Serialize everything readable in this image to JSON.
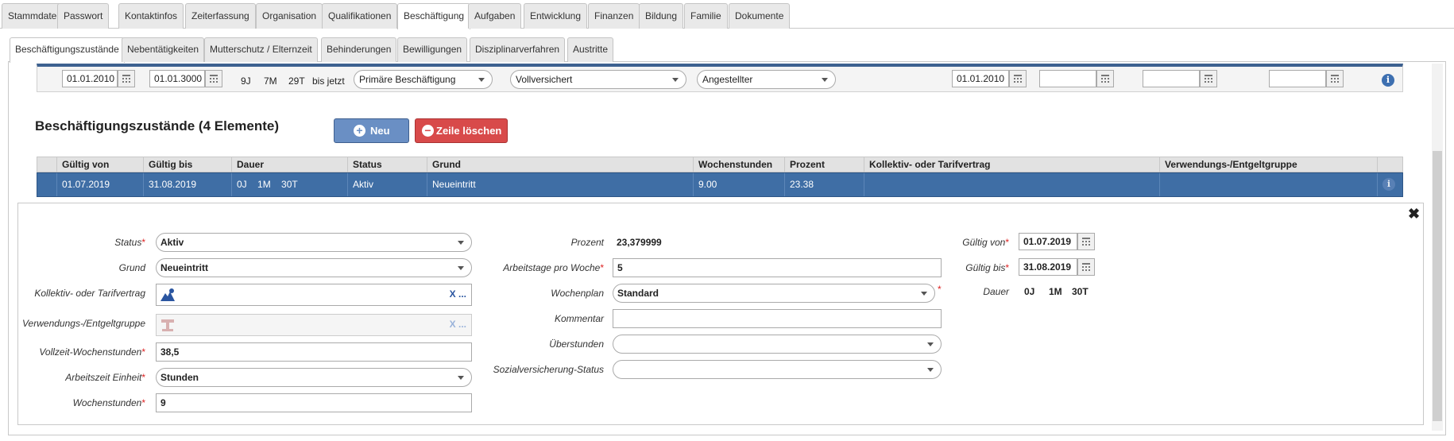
{
  "tabs_main": [
    "Stammdaten",
    "Passwort",
    "Kontaktinfos",
    "Zeiterfassung",
    "Organisation",
    "Qualifikationen",
    "Beschäftigung",
    "Aufgaben",
    "Entwicklung",
    "Finanzen",
    "Bildung",
    "Familie",
    "Dokumente"
  ],
  "tabs_main_active": "Beschäftigung",
  "tabs_sub": [
    "Beschäftigungszustände",
    "Nebentätigkeiten",
    "Mutterschutz / Elternzeit",
    "Behinderungen",
    "Bewilligungen",
    "Disziplinarverfahren",
    "Austritte"
  ],
  "tabs_sub_active": "Beschäftigungszustände",
  "top_row": {
    "from": "01.01.2010",
    "to": "01.01.3000",
    "dur_y": "9J",
    "dur_m": "7M",
    "dur_d": "29T",
    "until": "bis jetzt",
    "employment": "Primäre Beschäftigung",
    "insurance": "Vollversichert",
    "type": "Angestellter",
    "date2": "01.01.2010",
    "date3": "",
    "date4": "",
    "date5": ""
  },
  "section": {
    "title": "Beschäftigungszustände (4 Elemente)",
    "new_label": "Neu",
    "delete_label": "Zeile löschen"
  },
  "table": {
    "headers": [
      "Gültig von",
      "Gültig bis",
      "Dauer",
      "Status",
      "Grund",
      "Wochenstunden",
      "Prozent",
      "Kollektiv- oder Tarifvertrag",
      "Verwendungs-/Entgeltgruppe"
    ],
    "row": {
      "from": "01.07.2019",
      "to": "31.08.2019",
      "dur_y": "0J",
      "dur_m": "1M",
      "dur_d": "30T",
      "status": "Aktiv",
      "reason": "Neueintritt",
      "hours": "9.00",
      "percent": "23.38",
      "contract": "",
      "group": ""
    }
  },
  "form": {
    "status_label": "Status",
    "status_value": "Aktiv",
    "grund_label": "Grund",
    "grund_value": "Neueintritt",
    "tarif_label": "Kollektiv- oder Tarifvertrag",
    "entgelt_label": "Verwendungs-/Entgeltgruppe",
    "lookup_x": "X ...",
    "vollzeit_label": "Vollzeit-Wochenstunden",
    "vollzeit_value": "38,5",
    "einheit_label": "Arbeitszeit Einheit",
    "einheit_value": "Stunden",
    "wochenstunden_label": "Wochenstunden",
    "wochenstunden_value": "9",
    "prozent_label": "Prozent",
    "prozent_value": "23,379999",
    "arbeitstage_label": "Arbeitstage pro Woche",
    "arbeitstage_value": "5",
    "wochenplan_label": "Wochenplan",
    "wochenplan_value": "Standard",
    "kommentar_label": "Kommentar",
    "kommentar_value": "",
    "ueberstunden_label": "Überstunden",
    "ueberstunden_value": "",
    "sv_label": "Sozialversicherung-Status",
    "sv_value": "",
    "gueltig_von_label": "Gültig von",
    "gueltig_von_value": "01.07.2019",
    "gueltig_bis_label": "Gültig bis",
    "gueltig_bis_value": "31.08.2019",
    "dauer_label": "Dauer",
    "dauer_y": "0J",
    "dauer_m": "1M",
    "dauer_d": "30T",
    "required_mark": "*",
    "close_glyph": "✖"
  },
  "icons": {
    "info": "info-icon",
    "calendar": "calendar-icon",
    "plus": "plus-circle-icon",
    "minus": "minus-circle-icon"
  },
  "colors": {
    "accent": "#3f6ea5",
    "danger": "#d84a4a",
    "primary_btn": "#6a8fc4"
  }
}
